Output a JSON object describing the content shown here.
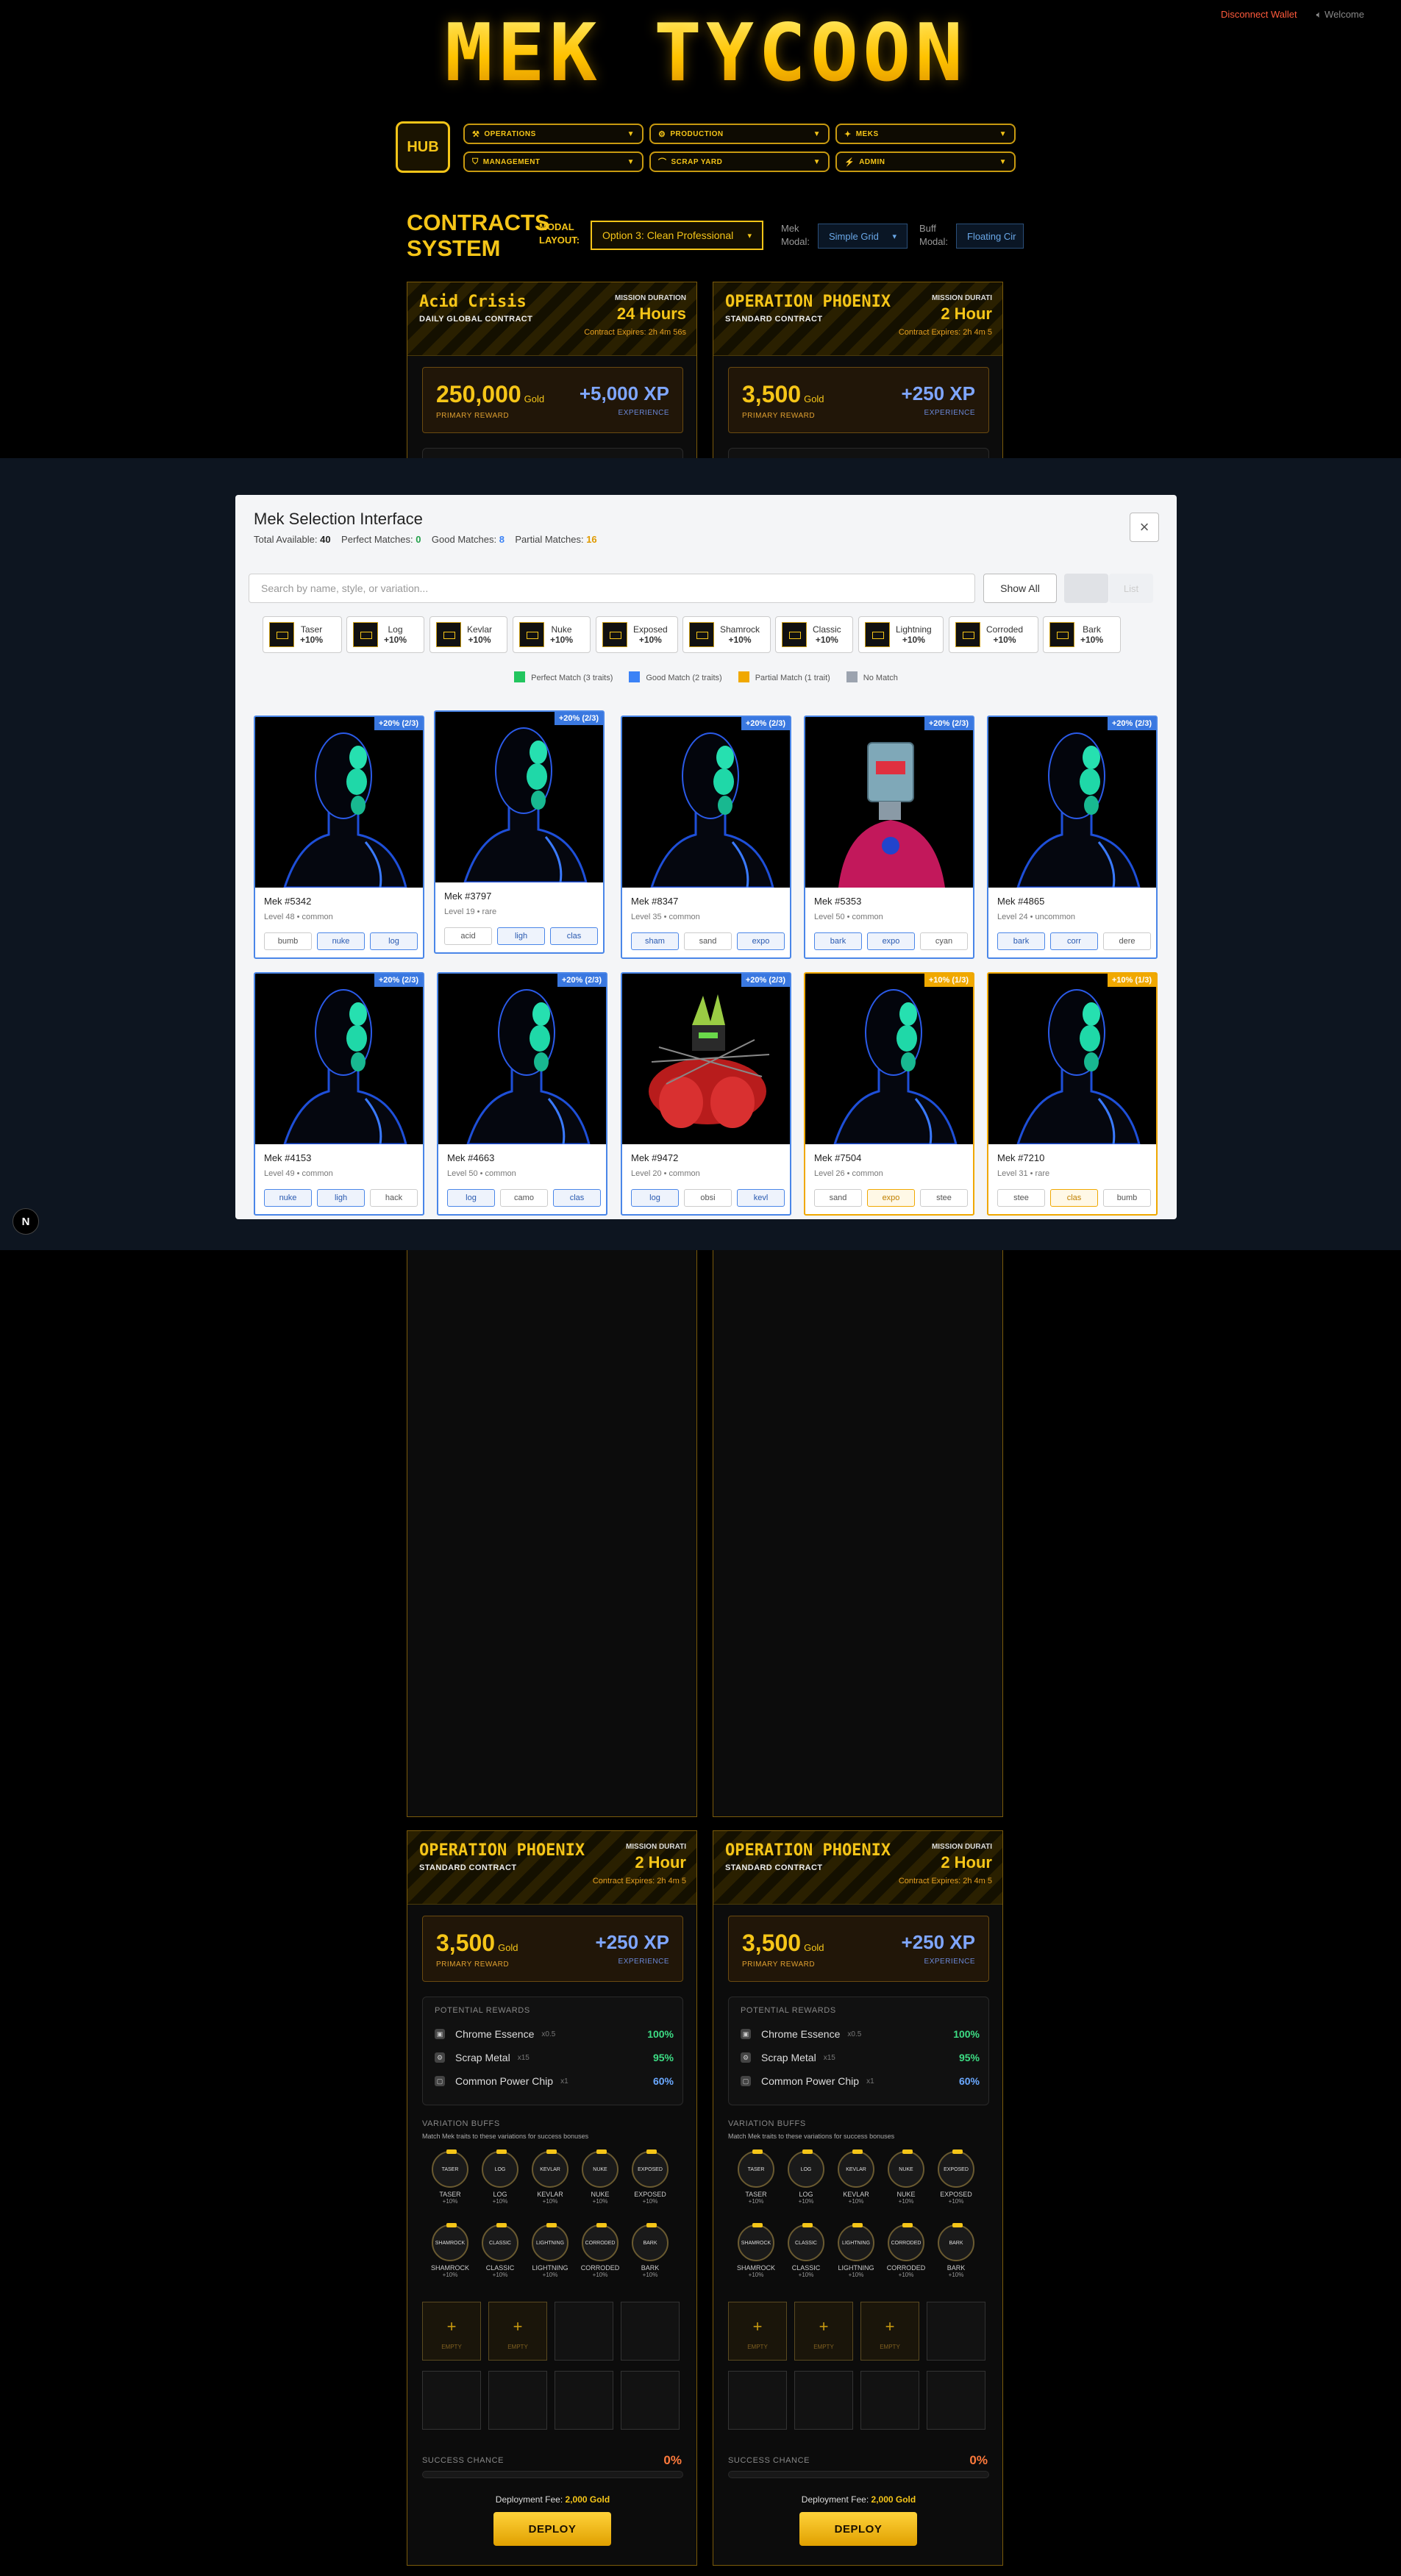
{
  "header": {
    "disconnect": "Disconnect Wallet",
    "welcome": "Welcome",
    "logo": "MEK TYCOON"
  },
  "nav": {
    "hub": "HUB",
    "items": [
      {
        "icon": "⚒",
        "label": "OPERATIONS"
      },
      {
        "icon": "⚙",
        "label": "PRODUCTION"
      },
      {
        "icon": "✦",
        "label": "MEKS"
      },
      {
        "icon": "⛉",
        "label": "MANAGEMENT"
      },
      {
        "icon": "⌒",
        "label": "SCRAP YARD"
      },
      {
        "icon": "⚡",
        "label": "ADMIN"
      }
    ]
  },
  "contracts": {
    "title1": "CONTRACTS",
    "title2": "SYSTEM",
    "modal_layout_label1": "MODAL",
    "modal_layout_label2": "LAYOUT:",
    "modal_layout_value": "Option 3: Clean Professional",
    "mek_modal_label1": "Mek",
    "mek_modal_label2": "Modal:",
    "mek_modal_value": "Simple Grid",
    "buff_modal_label1": "Buff",
    "buff_modal_label2": "Modal:",
    "buff_modal_value": "Floating Cir"
  },
  "cards": [
    {
      "name": "Acid Crisis",
      "sub": "DAILY GLOBAL CONTRACT",
      "mission": "MISSION DURATION",
      "duration": "24 Hours",
      "expires": "Contract Expires: 2h 4m 56s",
      "gold": "250,000",
      "gold_unit": "Gold",
      "primary": "PRIMARY REWARD",
      "xp": "+5,000 XP",
      "xp_label": "EXPERIENCE"
    },
    {
      "name": "OPERATION PHOENIX",
      "sub": "STANDARD CONTRACT",
      "mission": "MISSION DURATI",
      "duration": "2 Hour",
      "expires": "Contract Expires: 2h 4m 5",
      "gold": "3,500",
      "gold_unit": "Gold",
      "primary": "PRIMARY REWARD",
      "xp": "+250 XP",
      "xp_label": "EXPERIENCE"
    },
    {
      "name": "OPERATION PHOENIX",
      "sub": "STANDARD CONTRACT",
      "mission": "MISSION DURATI",
      "duration": "2 Hour",
      "expires": "Contract Expires: 2h 4m 5",
      "gold": "3,500",
      "gold_unit": "Gold",
      "primary": "PRIMARY REWARD",
      "xp": "+250 XP",
      "xp_label": "EXPERIENCE"
    },
    {
      "name": "OPERATION PHOENIX",
      "sub": "STANDARD CONTRACT",
      "mission": "MISSION DURATI",
      "duration": "2 Hour",
      "expires": "Contract Expires: 2h 4m 5",
      "gold": "3,500",
      "gold_unit": "Gold",
      "primary": "PRIMARY REWARD",
      "xp": "+250 XP",
      "xp_label": "EXPERIENCE"
    }
  ],
  "potential": {
    "title": "POTENTIAL REWARDS",
    "items": [
      {
        "icon": "▣",
        "name": "Chrome Essence",
        "qty": "x0.5",
        "pct": "100%",
        "color": "#3ddc84"
      },
      {
        "icon": "⚙",
        "name": "Scrap Metal",
        "qty": "x15",
        "pct": "95%",
        "color": "#3ddc84"
      },
      {
        "icon": "▢",
        "name": "Common Power Chip",
        "qty": "x1",
        "pct": "60%",
        "color": "#6aa8ff"
      }
    ]
  },
  "buffs": {
    "title": "VARIATION BUFFS",
    "subtitle": "Match Mek traits to these variations for success bonuses",
    "items": [
      {
        "circle": "TASER",
        "name": "TASER",
        "pct": "+10%"
      },
      {
        "circle": "LOG",
        "name": "LOG",
        "pct": "+10%"
      },
      {
        "circle": "KEVLAR",
        "name": "KEVLAR",
        "pct": "+10%"
      },
      {
        "circle": "NUKE",
        "name": "NUKE",
        "pct": "+10%"
      },
      {
        "circle": "EXPOSED",
        "name": "EXPOSED",
        "pct": "+10%"
      },
      {
        "circle": "SHAMROCK",
        "name": "SHAMROCK",
        "pct": "+10%"
      },
      {
        "circle": "CLASSIC",
        "name": "CLASSIC",
        "pct": "+10%"
      },
      {
        "circle": "LIGHTNING",
        "name": "LIGHTNING",
        "pct": "+10%"
      },
      {
        "circle": "CORRODED",
        "name": "CORRODED",
        "pct": "+10%"
      },
      {
        "circle": "BARK",
        "name": "BARK",
        "pct": "+10%"
      }
    ]
  },
  "slots": {
    "plus": "+",
    "empty": "EMPTY"
  },
  "success": {
    "label": "SUCCESS CHANCE",
    "value": "0%"
  },
  "fee": {
    "label": "Deployment Fee:",
    "value": "2,000 Gold"
  },
  "deploy": "DEPLOY",
  "modal": {
    "title": "Mek Selection Interface",
    "total_label": "Total Available:",
    "total": "40",
    "perfect_label": "Perfect Matches:",
    "perfect": "0",
    "good_label": "Good Matches:",
    "good": "8",
    "partial_label": "Partial Matches:",
    "partial": "16",
    "search_placeholder": "Search by name, style, or variation...",
    "show_all": "Show All",
    "list": "List",
    "close": "×",
    "chips": [
      {
        "name": "Taser",
        "bonus": "+10%"
      },
      {
        "name": "Log",
        "bonus": "+10%"
      },
      {
        "name": "Kevlar",
        "bonus": "+10%"
      },
      {
        "name": "Nuke",
        "bonus": "+10%"
      },
      {
        "name": "Exposed",
        "bonus": "+10%"
      },
      {
        "name": "Shamrock",
        "bonus": "+10%"
      },
      {
        "name": "Classic",
        "bonus": "+10%"
      },
      {
        "name": "Lightning",
        "bonus": "+10%"
      },
      {
        "name": "Corroded",
        "bonus": "+10%"
      },
      {
        "name": "Bark",
        "bonus": "+10%"
      }
    ],
    "legend": [
      {
        "label": "Perfect Match (3 traits)",
        "color": "#22c55e"
      },
      {
        "label": "Good Match (2 traits)",
        "color": "#3b82f6"
      },
      {
        "label": "Partial Match (1 trait)",
        "color": "#f0a800"
      },
      {
        "label": "No Match",
        "color": "#9ca3af"
      }
    ],
    "meks": [
      {
        "name": "Mek #5342",
        "level": "Level 48 • common",
        "badge": "+20% (2/3)",
        "tags": [
          [
            "bumb",
            ""
          ],
          [
            "nuke",
            "m"
          ],
          [
            "log",
            "m"
          ]
        ]
      },
      {
        "name": "Mek #3797",
        "level": "Level 19 • rare",
        "badge": "+20% (2/3)",
        "tags": [
          [
            "acid",
            ""
          ],
          [
            "ligh",
            "m"
          ],
          [
            "clas",
            "m"
          ]
        ]
      },
      {
        "name": "Mek #8347",
        "level": "Level 35 • common",
        "badge": "+20% (2/3)",
        "tags": [
          [
            "sham",
            "m"
          ],
          [
            "sand",
            ""
          ],
          [
            "expo",
            "m"
          ]
        ]
      },
      {
        "name": "Mek #5353",
        "level": "Level 50 • common",
        "badge": "+20% (2/3)",
        "tags": [
          [
            "bark",
            "m"
          ],
          [
            "expo",
            "m"
          ],
          [
            "cyan",
            ""
          ]
        ]
      },
      {
        "name": "Mek #4865",
        "level": "Level 24 • uncommon",
        "badge": "+20% (2/3)",
        "tags": [
          [
            "bark",
            "m"
          ],
          [
            "corr",
            "m"
          ],
          [
            "dere",
            ""
          ]
        ]
      },
      {
        "name": "Mek #4153",
        "level": "Level 49 • common",
        "badge": "+20% (2/3)",
        "tags": [
          [
            "nuke",
            "m"
          ],
          [
            "ligh",
            "m"
          ],
          [
            "hack",
            ""
          ]
        ]
      },
      {
        "name": "Mek #4663",
        "level": "Level 50 • common",
        "badge": "+20% (2/3)",
        "tags": [
          [
            "log",
            "m"
          ],
          [
            "camo",
            ""
          ],
          [
            "clas",
            "m"
          ]
        ]
      },
      {
        "name": "Mek #9472",
        "level": "Level 20 • common",
        "badge": "+20% (2/3)",
        "tags": [
          [
            "log",
            "m"
          ],
          [
            "obsi",
            ""
          ],
          [
            "kevl",
            "m"
          ]
        ]
      },
      {
        "name": "Mek #7504",
        "level": "Level 26 • common",
        "badge": "+10% (1/3)",
        "tags": [
          [
            "sand",
            ""
          ],
          [
            "expo",
            "p"
          ],
          [
            "stee",
            ""
          ]
        ]
      },
      {
        "name": "Mek #7210",
        "level": "Level 31 • rare",
        "badge": "+10% (1/3)",
        "tags": [
          [
            "stee",
            ""
          ],
          [
            "clas",
            "p"
          ],
          [
            "bumb",
            ""
          ]
        ]
      }
    ]
  },
  "next_badge": "N"
}
